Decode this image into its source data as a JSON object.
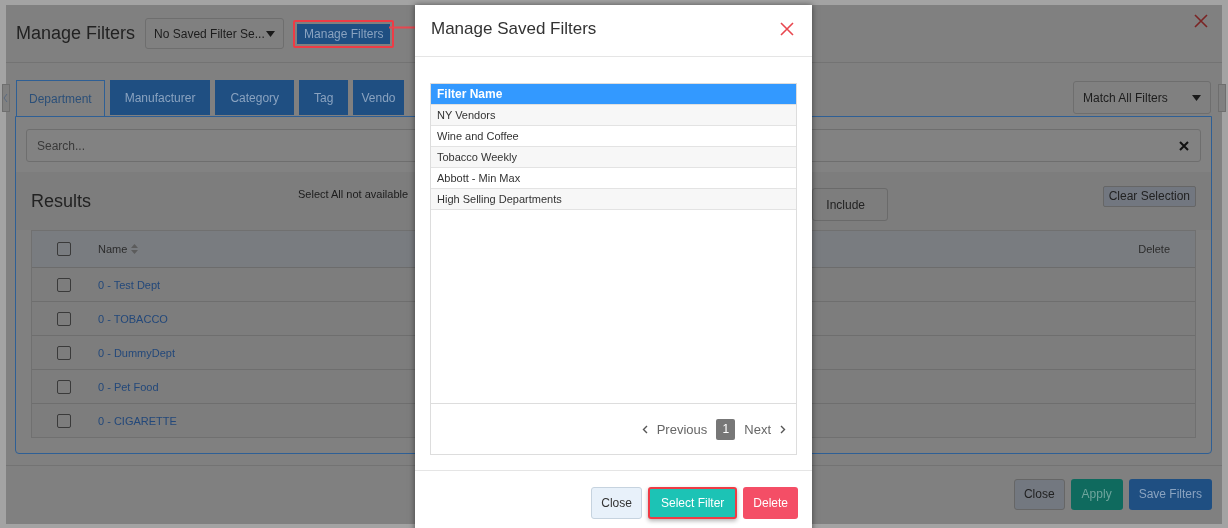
{
  "page": {
    "title": "Manage Filters",
    "saved_filter_select": {
      "value": "No Saved Filter Se..."
    },
    "manage_button": {
      "label": "Manage Filters",
      "highlighted": true
    },
    "tabs": [
      {
        "label": "Department",
        "selected": true
      },
      {
        "label": "Manufacturer",
        "selected": false
      },
      {
        "label": "Category",
        "selected": false
      },
      {
        "label": "Tag",
        "selected": false
      },
      {
        "label": "Vendo",
        "selected": false
      }
    ],
    "match_select": {
      "value": "Match All Filters"
    },
    "search": {
      "placeholder": "Search..."
    },
    "results": {
      "title": "Results",
      "select_all_checked": false,
      "note": "Select All not available",
      "include_button": "Include",
      "clear_button": "Clear Selection",
      "columns": [
        {
          "label": "Name",
          "sortable": true
        },
        {
          "label": "Delete",
          "sortable": false
        }
      ],
      "rows": [
        {
          "name": "0 - Test Dept",
          "checked": false
        },
        {
          "name": "0 - TOBACCO",
          "checked": false
        },
        {
          "name": "0 - DummyDept",
          "checked": false
        },
        {
          "name": "0 - Pet Food",
          "checked": false
        },
        {
          "name": "0 - CIGARETTE",
          "checked": false
        }
      ]
    },
    "footer_buttons": [
      {
        "label": "Close",
        "kind": "default"
      },
      {
        "label": "Apply",
        "kind": "success"
      },
      {
        "label": "Save Filters",
        "kind": "primary"
      }
    ]
  },
  "modal": {
    "title": "Manage Saved Filters",
    "column": "Filter Name",
    "filters": [
      "NY Vendors",
      "Wine and Coffee",
      "Tobacco Weekly",
      "Abbott - Min Max",
      "High Selling Departments"
    ],
    "pagination": {
      "previous": "Previous",
      "page": "1",
      "next": "Next"
    },
    "buttons": [
      {
        "label": "Close",
        "kind": "default",
        "highlighted": false
      },
      {
        "label": "Select Filter",
        "kind": "success",
        "highlighted": true
      },
      {
        "label": "Delete",
        "kind": "danger",
        "highlighted": false
      }
    ]
  }
}
